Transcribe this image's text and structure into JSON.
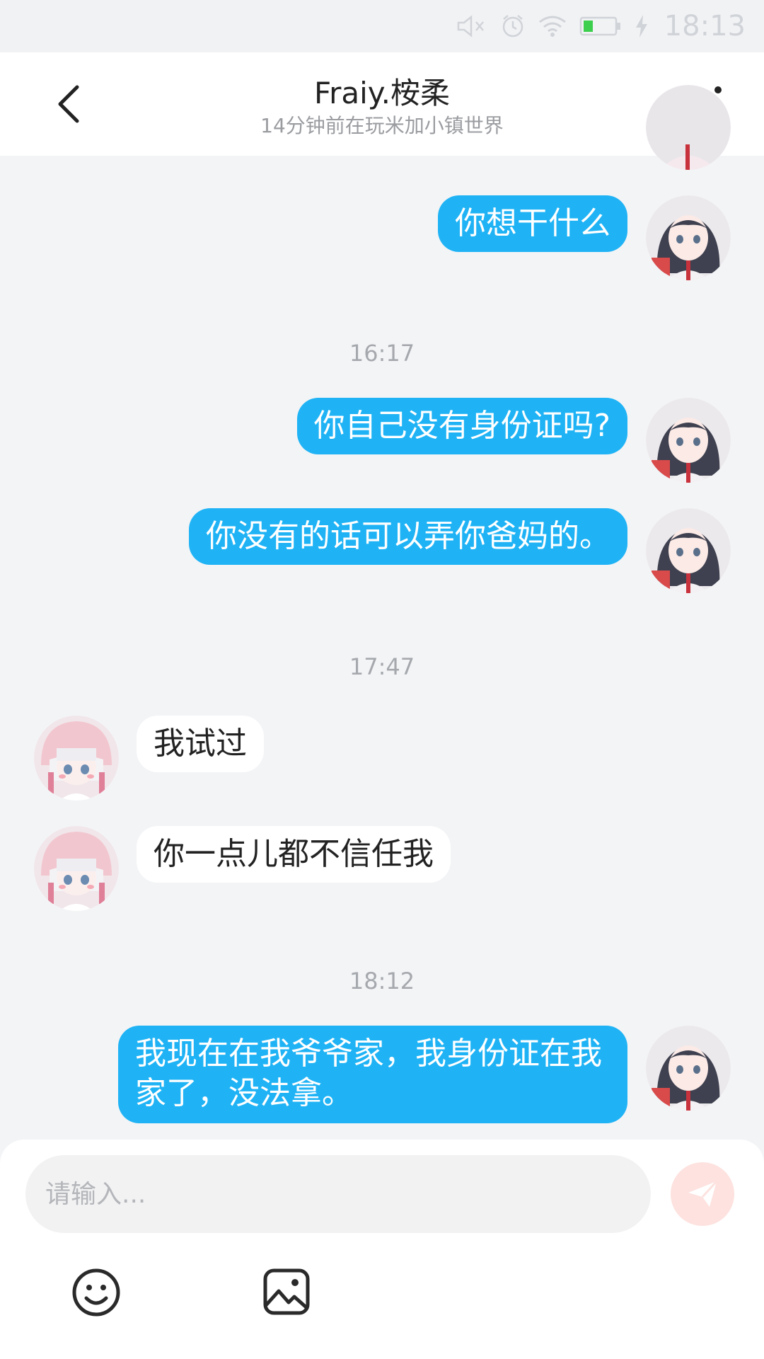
{
  "status_bar": {
    "time": "18:13",
    "icons": [
      "mute-icon",
      "alarm-icon",
      "wifi-icon",
      "battery-icon",
      "charging-icon"
    ]
  },
  "header": {
    "title": "Fraiy.桉柔",
    "subtitle": "14分钟前在玩米加小镇世界",
    "back_icon": "chevron-left-icon",
    "more_icon": "more-vertical-icon"
  },
  "messages": [
    {
      "type": "message",
      "side": "out",
      "text": "你想干什么"
    },
    {
      "type": "time",
      "text": "16:17"
    },
    {
      "type": "message",
      "side": "out",
      "text": "你自己没有身份证吗?"
    },
    {
      "type": "message",
      "side": "out",
      "text": "你没有的话可以弄你爸妈的。"
    },
    {
      "type": "time",
      "text": "17:47"
    },
    {
      "type": "message",
      "side": "in",
      "text": "我试过"
    },
    {
      "type": "message",
      "side": "in",
      "text": "你一点儿都不信任我"
    },
    {
      "type": "time",
      "text": "18:12"
    },
    {
      "type": "message",
      "side": "out",
      "text": "我现在在我爷爷家，我身份证在我家了，没法拿。"
    }
  ],
  "composer": {
    "placeholder": "请输入...",
    "value": "",
    "send_icon": "send-icon",
    "emoji_icon": "emoji-icon",
    "image_icon": "image-icon"
  },
  "colors": {
    "outgoing_bubble": "#1fb3f5",
    "incoming_bubble": "#ffffff",
    "background": "#f3f4f6",
    "send_button": "#fde2df"
  }
}
